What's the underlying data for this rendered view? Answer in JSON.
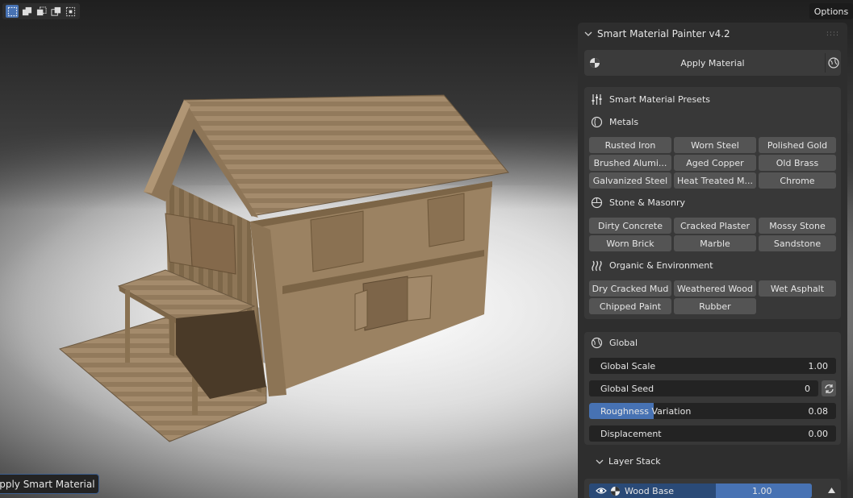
{
  "toolbar": {
    "tools": [
      "select-box-icon",
      "select-extend-icon",
      "select-subtract-icon",
      "select-invert-icon",
      "select-intersect-icon"
    ]
  },
  "header": {
    "options_label": "Options"
  },
  "operator_panel": {
    "label": "Apply Smart Material"
  },
  "addon_panel": {
    "title": "Smart Material Painter v4.2",
    "apply_label": "Apply Material",
    "presets": {
      "title": "Smart Material Presets",
      "categories": [
        {
          "name": "Metals",
          "items": [
            "Rusted Iron",
            "Worn Steel",
            "Polished Gold",
            "Brushed Alumi...",
            "Aged Copper",
            "Old Brass",
            "Galvanized Steel",
            "Heat Treated M...",
            "Chrome"
          ]
        },
        {
          "name": "Stone & Masonry",
          "items": [
            "Dirty Concrete",
            "Cracked Plaster",
            "Mossy Stone",
            "Worn Brick",
            "Marble",
            "Sandstone"
          ]
        },
        {
          "name": "Organic & Environment",
          "items": [
            "Dry Cracked Mud",
            "Weathered Wood",
            "Wet Asphalt",
            "Chipped Paint",
            "Rubber"
          ]
        }
      ]
    },
    "global": {
      "title": "Global",
      "scale_label": "Global Scale",
      "scale_value": "1.00",
      "seed_label": "Global Seed",
      "seed_value": "0",
      "roughness_label": "Roughness Variation",
      "roughness_value": "0.08",
      "roughness_fraction": 0.26,
      "displacement_label": "Displacement",
      "displacement_value": "0.00"
    },
    "layer_stack": {
      "title": "Layer Stack",
      "layers": [
        {
          "name": "Wood Base",
          "value": "1.00"
        }
      ]
    }
  },
  "colors": {
    "accent": "#4772b3",
    "panel": "#2e2e2e",
    "wood": "#9c8466"
  }
}
